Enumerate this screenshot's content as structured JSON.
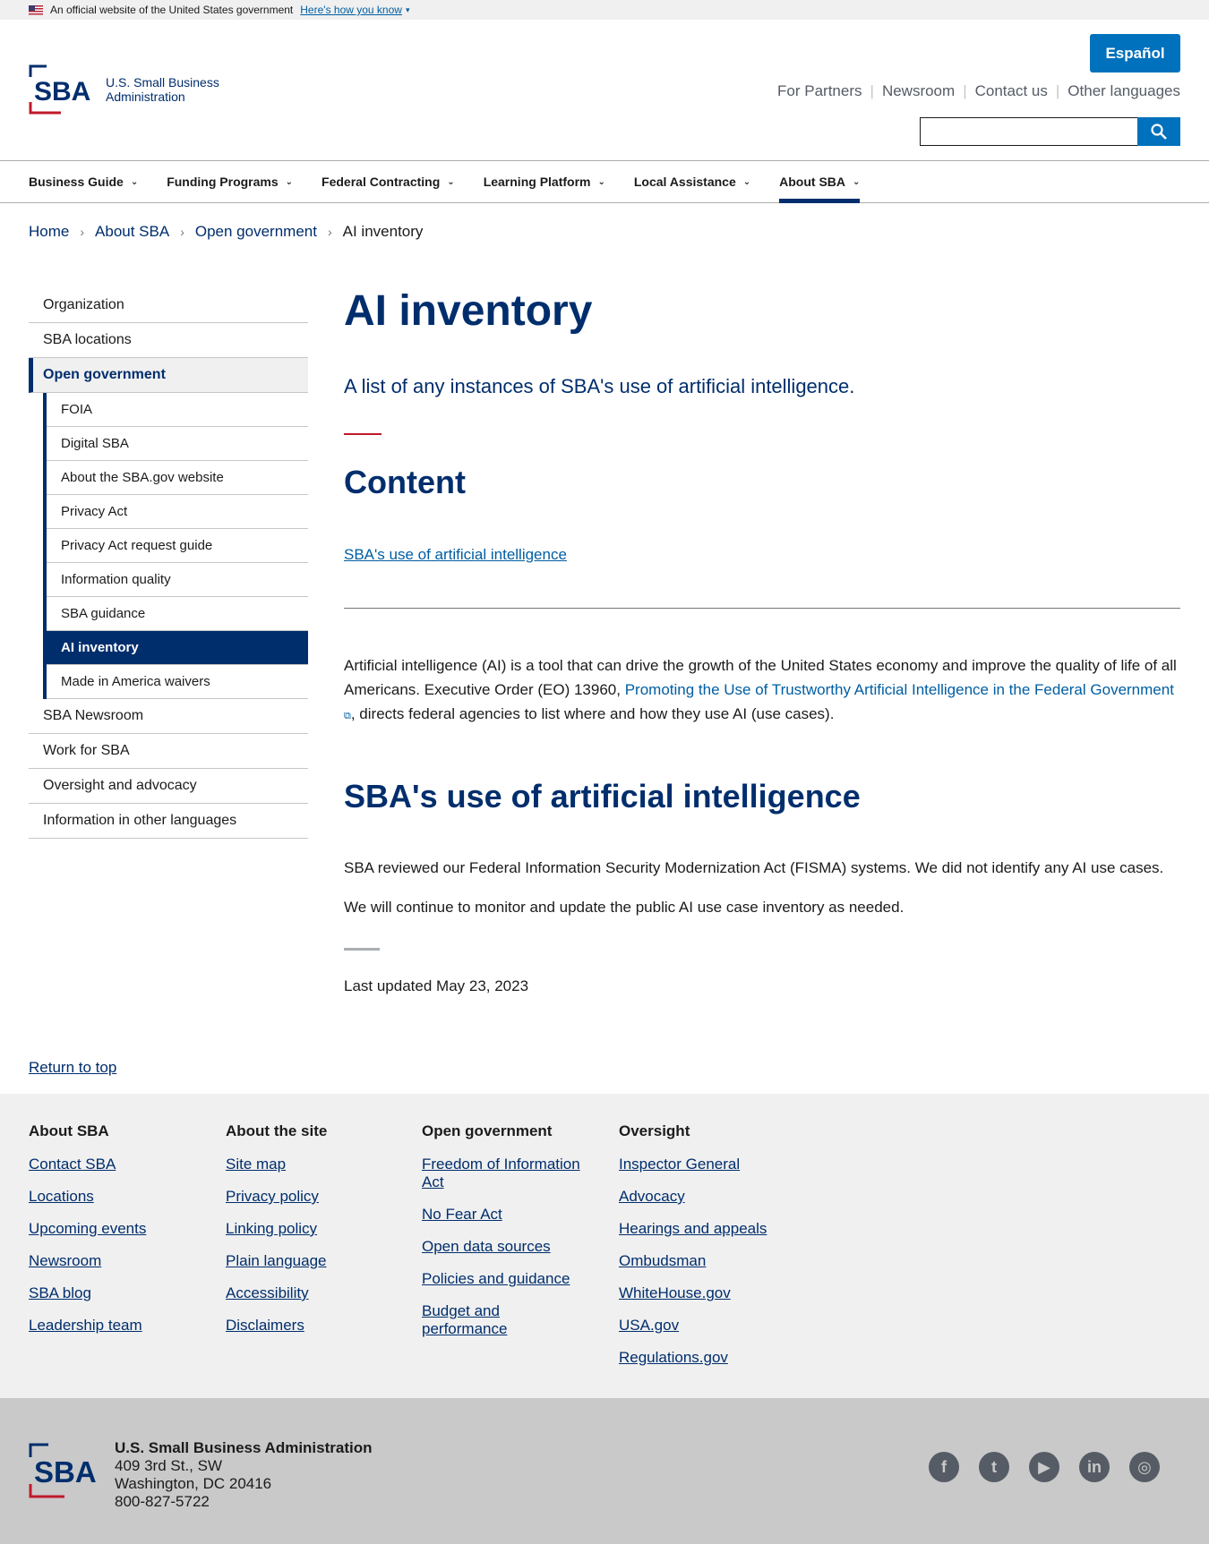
{
  "gov_banner": {
    "text": "An official website of the United States government",
    "how": "Here's how you know"
  },
  "header": {
    "logo_line1": "U.S. Small Business",
    "logo_line2": "Administration",
    "espanol": "Español",
    "util_links": [
      "For Partners",
      "Newsroom",
      "Contact us",
      "Other languages"
    ],
    "search_placeholder": ""
  },
  "nav": [
    "Business Guide",
    "Funding Programs",
    "Federal Contracting",
    "Learning Platform",
    "Local Assistance",
    "About SBA"
  ],
  "breadcrumb": [
    "Home",
    "About SBA",
    "Open government",
    "AI inventory"
  ],
  "sidenav": {
    "top": [
      "Organization",
      "SBA locations"
    ],
    "current": "Open government",
    "sub": [
      "FOIA",
      "Digital SBA",
      "About the SBA.gov website",
      "Privacy Act",
      "Privacy Act request guide",
      "Information quality",
      "SBA guidance",
      "AI inventory",
      "Made in America waivers"
    ],
    "bottom": [
      "SBA Newsroom",
      "Work for SBA",
      "Oversight and advocacy",
      "Information in other languages"
    ]
  },
  "main": {
    "title": "AI inventory",
    "lead": "A list of any instances of SBA's use of artificial intelligence.",
    "content_heading": "Content",
    "toc_link": "SBA's use of artificial intelligence",
    "para1_a": "Artificial intelligence (AI) is a tool that can drive the growth of the United States economy and improve the quality of life of all Americans. Executive Order (EO) 13960,",
    "para1_link": "Promoting the Use of Trustworthy Artificial Intelligence in the Federal Government",
    "para1_b": ", directs federal agencies to list where and how they use AI (use cases).",
    "section_heading": "SBA's use of artificial intelligence",
    "para2": "SBA reviewed our Federal Information Security Modernization Act (FISMA) systems. We did not identify any AI use cases.",
    "para3": "We will continue to monitor and update the public AI use case inventory as needed.",
    "updated": "Last updated May 23, 2023"
  },
  "return_top": "Return to top",
  "footer": {
    "cols": [
      {
        "title": "About SBA",
        "links": [
          "Contact SBA",
          "Locations",
          "Upcoming events",
          "Newsroom",
          "SBA blog",
          "Leadership team"
        ]
      },
      {
        "title": "About the site",
        "links": [
          "Site map",
          "Privacy policy",
          "Linking policy",
          "Plain language",
          "Accessibility",
          "Disclaimers"
        ]
      },
      {
        "title": "Open government",
        "links": [
          "Freedom of Information Act",
          "No Fear Act",
          "Open data sources",
          "Policies and guidance",
          "Budget and performance"
        ]
      },
      {
        "title": "Oversight",
        "links": [
          "Inspector General",
          "Advocacy",
          "Hearings and appeals",
          "Ombudsman",
          "WhiteHouse.gov",
          "USA.gov",
          "Regulations.gov"
        ]
      }
    ],
    "org": "U.S. Small Business Administration",
    "addr1": "409 3rd St., SW",
    "addr2": "Washington, DC 20416",
    "phone": "800-827-5722",
    "social": [
      "facebook-icon",
      "twitter-icon",
      "youtube-icon",
      "linkedin-icon",
      "instagram-icon"
    ]
  },
  "colors": {
    "navy": "#002e6d",
    "link": "#005ea2",
    "button": "#0071bc",
    "accent_red": "#c0192b"
  }
}
